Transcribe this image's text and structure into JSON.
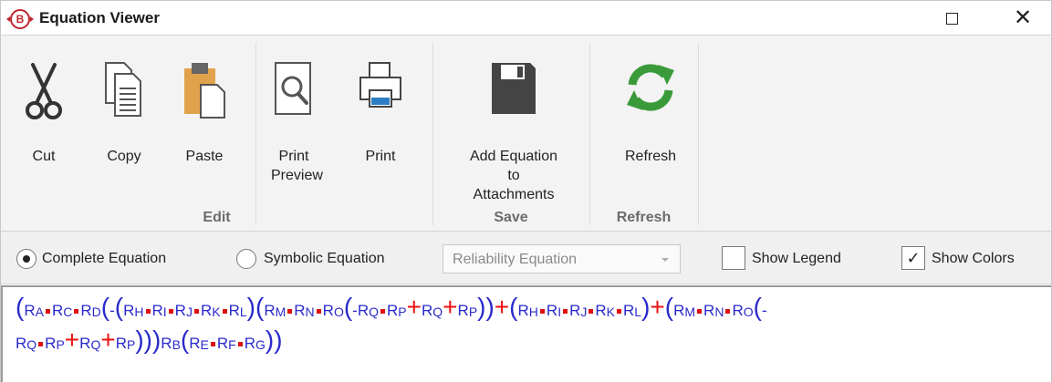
{
  "window": {
    "title": "Equation Viewer",
    "maximize_glyph": "☐",
    "close_glyph": "✕"
  },
  "ribbon": {
    "groups": [
      {
        "label": "Edit",
        "buttons": [
          {
            "label": "Cut",
            "icon": "scissors-icon"
          },
          {
            "label": "Copy",
            "icon": "copy-icon"
          },
          {
            "label": "Paste",
            "icon": "paste-icon"
          },
          {
            "label": "Print Preview",
            "icon": "print-preview-icon"
          },
          {
            "label": "Print",
            "icon": "printer-icon"
          }
        ]
      },
      {
        "label": "Save",
        "buttons": [
          {
            "label": "Add Equation to Attachments",
            "icon": "floppy-disk-icon"
          }
        ]
      },
      {
        "label": "Refresh",
        "buttons": [
          {
            "label": "Refresh",
            "icon": "refresh-icon"
          }
        ]
      }
    ]
  },
  "options": {
    "complete_equation": "Complete Equation",
    "symbolic_equation": "Symbolic Equation",
    "selected_mode": "Complete Equation",
    "equation_type": "Reliability Equation",
    "show_legend": "Show Legend",
    "show_legend_checked": false,
    "show_colors": "Show Colors",
    "show_colors_checked": true
  },
  "colors": {
    "paren": "#2a2acc",
    "variable": "#2a2acc",
    "operator": "#ee1111",
    "ribbon_bg": "#f3f3f3",
    "logo": "#c0262d",
    "refresh": "#3a9a3a"
  },
  "equation": {
    "lines": [
      [
        {
          "t": "p",
          "v": "("
        },
        {
          "t": "r",
          "s": "A"
        },
        {
          "t": "d"
        },
        {
          "t": "r",
          "s": "C"
        },
        {
          "t": "d"
        },
        {
          "t": "r",
          "s": "D"
        },
        {
          "t": "p",
          "v": "("
        },
        {
          "t": "m",
          "v": "-"
        },
        {
          "t": "p",
          "v": "("
        },
        {
          "t": "r",
          "s": "H"
        },
        {
          "t": "d"
        },
        {
          "t": "r",
          "s": "I"
        },
        {
          "t": "d"
        },
        {
          "t": "r",
          "s": "J"
        },
        {
          "t": "d"
        },
        {
          "t": "r",
          "s": "K"
        },
        {
          "t": "d"
        },
        {
          "t": "r",
          "s": "L"
        },
        {
          "t": "p",
          "v": ")"
        },
        {
          "t": "p",
          "v": "("
        },
        {
          "t": "r",
          "s": "M"
        },
        {
          "t": "d"
        },
        {
          "t": "r",
          "s": "N"
        },
        {
          "t": "d"
        },
        {
          "t": "r",
          "s": "O"
        },
        {
          "t": "p",
          "v": "("
        },
        {
          "t": "m",
          "v": "-"
        },
        {
          "t": "r",
          "s": "Q"
        },
        {
          "t": "d"
        },
        {
          "t": "r",
          "s": "P"
        },
        {
          "t": "o",
          "v": "+"
        },
        {
          "t": "r",
          "s": "Q"
        },
        {
          "t": "o",
          "v": "+"
        },
        {
          "t": "r",
          "s": "P"
        },
        {
          "t": "p",
          "v": ")"
        },
        {
          "t": "p",
          "v": ")"
        },
        {
          "t": "o",
          "v": "+"
        },
        {
          "t": "p",
          "v": "("
        },
        {
          "t": "r",
          "s": "H"
        },
        {
          "t": "d"
        },
        {
          "t": "r",
          "s": "I"
        },
        {
          "t": "d"
        },
        {
          "t": "r",
          "s": "J"
        },
        {
          "t": "d"
        },
        {
          "t": "r",
          "s": "K"
        },
        {
          "t": "d"
        },
        {
          "t": "r",
          "s": "L"
        },
        {
          "t": "p",
          "v": ")"
        },
        {
          "t": "o",
          "v": "+"
        },
        {
          "t": "p",
          "v": "("
        },
        {
          "t": "r",
          "s": "M"
        },
        {
          "t": "d"
        },
        {
          "t": "r",
          "s": "N"
        },
        {
          "t": "d"
        },
        {
          "t": "r",
          "s": "O"
        },
        {
          "t": "p",
          "v": "("
        },
        {
          "t": "m",
          "v": "-"
        }
      ],
      [
        {
          "t": "r",
          "s": "Q"
        },
        {
          "t": "d"
        },
        {
          "t": "r",
          "s": "P"
        },
        {
          "t": "o",
          "v": "+"
        },
        {
          "t": "r",
          "s": "Q"
        },
        {
          "t": "o",
          "v": "+"
        },
        {
          "t": "r",
          "s": "P"
        },
        {
          "t": "p",
          "v": ")"
        },
        {
          "t": "p",
          "v": ")"
        },
        {
          "t": "p",
          "v": ")"
        },
        {
          "t": "r",
          "s": "B"
        },
        {
          "t": "p",
          "v": "("
        },
        {
          "t": "r",
          "s": "E"
        },
        {
          "t": "d"
        },
        {
          "t": "r",
          "s": "F"
        },
        {
          "t": "d"
        },
        {
          "t": "r",
          "s": "G"
        },
        {
          "t": "p",
          "v": ")"
        },
        {
          "t": "p",
          "v": ")"
        }
      ]
    ]
  }
}
